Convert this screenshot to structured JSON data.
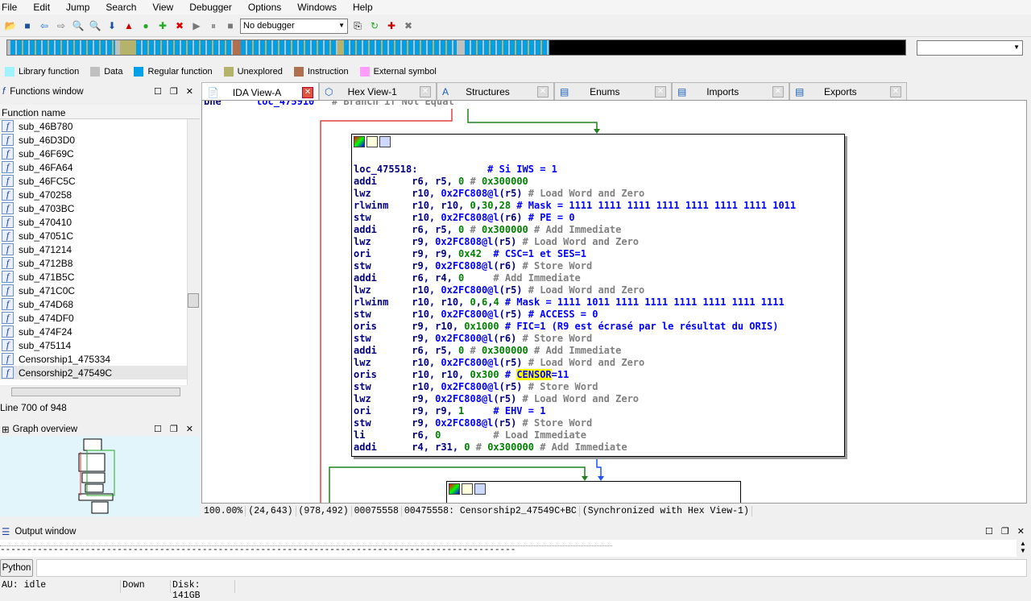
{
  "menu": [
    "File",
    "Edit",
    "Jump",
    "Search",
    "View",
    "Debugger",
    "Options",
    "Windows",
    "Help"
  ],
  "toolbar": {
    "debugger_select": "No debugger",
    "icons": [
      "open-icon",
      "save-icon",
      "back-icon",
      "forward-icon",
      "binary-search-icon",
      "text-search-icon",
      "jump-icon",
      "graph-icon",
      "run-icon",
      "add-struct-icon",
      "step-icon",
      "play-icon",
      "pause-icon",
      "stop-icon",
      "attach-icon",
      "detach-icon"
    ]
  },
  "legend": [
    {
      "label": "Library function",
      "color": "#9ff3ff"
    },
    {
      "label": "Data",
      "color": "#c0c0c0"
    },
    {
      "label": "Regular function",
      "color": "#00a0e8"
    },
    {
      "label": "Unexplored",
      "color": "#b5b36b"
    },
    {
      "label": "Instruction",
      "color": "#b07050"
    },
    {
      "label": "External symbol",
      "color": "#ff9cff"
    }
  ],
  "functions": {
    "title": "Functions window",
    "column": "Function name",
    "items": [
      "sub_46B780",
      "sub_46D3D0",
      "sub_46F69C",
      "sub_46FA64",
      "sub_46FC5C",
      "sub_470258",
      "sub_4703BC",
      "sub_470410",
      "sub_47051C",
      "sub_471214",
      "sub_4712B8",
      "sub_471B5C",
      "sub_471C0C",
      "sub_474D68",
      "sub_474DF0",
      "sub_474F24",
      "sub_475114",
      "Censorship1_475334",
      "Censorship2_47549C"
    ],
    "selected": "Censorship2_47549C",
    "line_status": "Line 700 of 948"
  },
  "graph_overview": {
    "title": "Graph overview"
  },
  "tabs": [
    {
      "label": "IDA View-A",
      "active": true
    },
    {
      "label": "Hex View-1"
    },
    {
      "label": "Structures"
    },
    {
      "label": "Enums"
    },
    {
      "label": "Imports"
    },
    {
      "label": "Exports"
    }
  ],
  "prev_line": [
    [
      "mn",
      "bne      "
    ],
    [
      "op",
      "loc_475910"
    ],
    [
      "ac",
      "   # Branch if Not Equal"
    ]
  ],
  "code": [
    [
      [
        "lb",
        "loc_475518:"
      ],
      [
        "cm",
        "            # Si IWS = 1"
      ]
    ],
    [
      [
        "mn",
        "addi      "
      ],
      [
        "mn",
        "r6, r5, "
      ],
      [
        "nm",
        "0"
      ],
      [
        "ac",
        " # "
      ],
      [
        "nm",
        "0x300000"
      ]
    ],
    [
      [
        "mn",
        "lwz       "
      ],
      [
        "mn",
        "r10, "
      ],
      [
        "op",
        "0x2FC808@l"
      ],
      [
        "mn",
        "(r5)"
      ],
      [
        "ac",
        " # Load Word and Zero"
      ]
    ],
    [
      [
        "mn",
        "rlwinm    "
      ],
      [
        "mn",
        "r10, r10, "
      ],
      [
        "nm",
        "0"
      ],
      [
        "mn",
        ","
      ],
      [
        "nm",
        "30"
      ],
      [
        "mn",
        ","
      ],
      [
        "nm",
        "28"
      ],
      [
        "cm",
        " # Mask = 1111 1111 1111 1111 1111 1111 1111 1011"
      ]
    ],
    [
      [
        "mn",
        "stw       "
      ],
      [
        "mn",
        "r10, "
      ],
      [
        "op",
        "0x2FC808@l"
      ],
      [
        "mn",
        "(r6)"
      ],
      [
        "cm",
        " # PE = 0"
      ]
    ],
    [
      [
        "mn",
        "addi      "
      ],
      [
        "mn",
        "r6, r5, "
      ],
      [
        "nm",
        "0"
      ],
      [
        "ac",
        " # "
      ],
      [
        "nm",
        "0x300000"
      ],
      [
        "ac",
        " # Add Immediate"
      ]
    ],
    [
      [
        "mn",
        "lwz       "
      ],
      [
        "mn",
        "r9, "
      ],
      [
        "op",
        "0x2FC808@l"
      ],
      [
        "mn",
        "(r5)"
      ],
      [
        "ac",
        " # Load Word and Zero"
      ]
    ],
    [
      [
        "mn",
        "ori       "
      ],
      [
        "mn",
        "r9, r9, "
      ],
      [
        "nm",
        "0x42"
      ],
      [
        "cm",
        "  # CSC=1 et SES=1"
      ]
    ],
    [
      [
        "mn",
        "stw       "
      ],
      [
        "mn",
        "r9, "
      ],
      [
        "op",
        "0x2FC808@l"
      ],
      [
        "mn",
        "(r6)"
      ],
      [
        "ac",
        " # Store Word"
      ]
    ],
    [
      [
        "mn",
        "addi      "
      ],
      [
        "mn",
        "r6, r4, "
      ],
      [
        "nm",
        "0"
      ],
      [
        "ac",
        "     # Add Immediate"
      ]
    ],
    [
      [
        "mn",
        "lwz       "
      ],
      [
        "mn",
        "r10, "
      ],
      [
        "op",
        "0x2FC800@l"
      ],
      [
        "mn",
        "(r5)"
      ],
      [
        "ac",
        " # Load Word and Zero"
      ]
    ],
    [
      [
        "mn",
        "rlwinm    "
      ],
      [
        "mn",
        "r10, r10, "
      ],
      [
        "nm",
        "0"
      ],
      [
        "mn",
        ","
      ],
      [
        "nm",
        "6"
      ],
      [
        "mn",
        ","
      ],
      [
        "nm",
        "4"
      ],
      [
        "cm",
        " # Mask = 1111 1011 1111 1111 1111 1111 1111 1111"
      ]
    ],
    [
      [
        "mn",
        "stw       "
      ],
      [
        "mn",
        "r10, "
      ],
      [
        "op",
        "0x2FC800@l"
      ],
      [
        "mn",
        "(r5)"
      ],
      [
        "cm",
        " # ACCESS = 0"
      ]
    ],
    [
      [
        "mn",
        "oris      "
      ],
      [
        "mn",
        "r9, r10, "
      ],
      [
        "nm",
        "0x1000"
      ],
      [
        "cm",
        " # FIC=1 (R9 est écrasé par le résultat du ORIS)"
      ]
    ],
    [
      [
        "mn",
        "stw       "
      ],
      [
        "mn",
        "r9, "
      ],
      [
        "op",
        "0x2FC800@l"
      ],
      [
        "mn",
        "(r6)"
      ],
      [
        "ac",
        " # Store Word"
      ]
    ],
    [
      [
        "mn",
        "addi      "
      ],
      [
        "mn",
        "r6, r5, "
      ],
      [
        "nm",
        "0"
      ],
      [
        "ac",
        " # "
      ],
      [
        "nm",
        "0x300000"
      ],
      [
        "ac",
        " # Add Immediate"
      ]
    ],
    [
      [
        "mn",
        "lwz       "
      ],
      [
        "mn",
        "r10, "
      ],
      [
        "op",
        "0x2FC800@l"
      ],
      [
        "mn",
        "(r5)"
      ],
      [
        "ac",
        " # Load Word and Zero"
      ]
    ],
    [
      [
        "mn",
        "oris      "
      ],
      [
        "mn",
        "r10, r10, "
      ],
      [
        "nm",
        "0x300"
      ],
      [
        "cm",
        " # "
      ],
      [
        "hl",
        "CENSOR"
      ],
      [
        "cm",
        "=11"
      ]
    ],
    [
      [
        "mn",
        "stw       "
      ],
      [
        "mn",
        "r10, "
      ],
      [
        "op",
        "0x2FC800@l"
      ],
      [
        "mn",
        "(r5)"
      ],
      [
        "ac",
        " # Store Word"
      ]
    ],
    [
      [
        "mn",
        "lwz       "
      ],
      [
        "mn",
        "r9, "
      ],
      [
        "op",
        "0x2FC808@l"
      ],
      [
        "mn",
        "(r5)"
      ],
      [
        "ac",
        " # Load Word and Zero"
      ]
    ],
    [
      [
        "mn",
        "ori       "
      ],
      [
        "mn",
        "r9, r9, "
      ],
      [
        "nm",
        "1"
      ],
      [
        "cm",
        "     # EHV = 1"
      ]
    ],
    [
      [
        "mn",
        "stw       "
      ],
      [
        "mn",
        "r9, "
      ],
      [
        "op",
        "0x2FC808@l"
      ],
      [
        "mn",
        "(r5)"
      ],
      [
        "ac",
        " # Store Word"
      ]
    ],
    [
      [
        "mn",
        "li        "
      ],
      [
        "mn",
        "r6, "
      ],
      [
        "nm",
        "0"
      ],
      [
        "ac",
        "         # Load Immediate"
      ]
    ],
    [
      [
        "mn",
        "addi      "
      ],
      [
        "mn",
        "r4, r31, "
      ],
      [
        "nm",
        "0"
      ],
      [
        "ac",
        " # "
      ],
      [
        "nm",
        "0x300000"
      ],
      [
        "ac",
        " # Add Immediate"
      ]
    ]
  ],
  "graph_status": [
    "100.00%",
    "(24,643)",
    "(978,492)",
    "00075558",
    "00475558: Censorship2_47549C+BC",
    "(Synchronized with Hex View-1)"
  ],
  "output": {
    "title": "Output window",
    "text": "-------------------------------------------------------------------------------------------------",
    "python_label": "Python"
  },
  "status": [
    "AU:  idle",
    "Down",
    "Disk: 141GB"
  ]
}
